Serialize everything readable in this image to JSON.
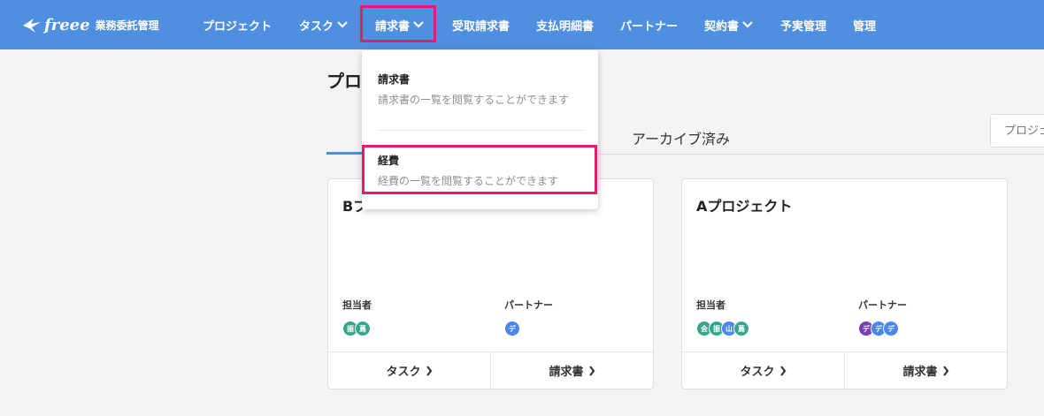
{
  "app": {
    "brand": "freee",
    "product": "業務委託管理"
  },
  "nav": {
    "items": [
      {
        "label": "プロジェクト"
      },
      {
        "label": "タスク"
      },
      {
        "label": "請求書"
      },
      {
        "label": "受取請求書"
      },
      {
        "label": "支払明細書"
      },
      {
        "label": "パートナー"
      },
      {
        "label": "契約書"
      },
      {
        "label": "予実管理"
      },
      {
        "label": "管理"
      }
    ]
  },
  "dropdown": {
    "items": [
      {
        "title": "請求書",
        "description": "請求書の一覧を閲覧することができます"
      },
      {
        "title": "経費",
        "description": "経費の一覧を閲覧することができます"
      }
    ]
  },
  "page": {
    "title": "プロ",
    "tabs": {
      "archived": "アーカイブ済み"
    },
    "search_placeholder": "プロジェ"
  },
  "cards": [
    {
      "title": "Bプ",
      "assignee_label": "担当者",
      "partner_label": "パートナー",
      "assignees": [
        {
          "initial": "振",
          "color": "#3aa58f"
        },
        {
          "initial": "蔦",
          "color": "#3aa58f"
        }
      ],
      "partners": [
        {
          "initial": "デ",
          "color": "#4a86e8"
        }
      ],
      "task_button": "タスク",
      "invoice_button": "請求書"
    },
    {
      "title": "Aプロジェクト",
      "assignee_label": "担当者",
      "partner_label": "パートナー",
      "assignees": [
        {
          "initial": "会",
          "color": "#3aa58f"
        },
        {
          "initial": "振",
          "color": "#3aa58f"
        },
        {
          "initial": "山",
          "color": "#4a86e8"
        },
        {
          "initial": "蔦",
          "color": "#3aa58f"
        }
      ],
      "partners": [
        {
          "initial": "デ",
          "color": "#7b3fb5"
        },
        {
          "initial": "デ",
          "color": "#4a86e8"
        },
        {
          "initial": "デ",
          "color": "#4a86e8"
        }
      ],
      "task_button": "タスク",
      "invoice_button": "請求書"
    }
  ],
  "colors": {
    "nav_bg": "#4f8fe0",
    "highlight": "#ea1a6b"
  }
}
